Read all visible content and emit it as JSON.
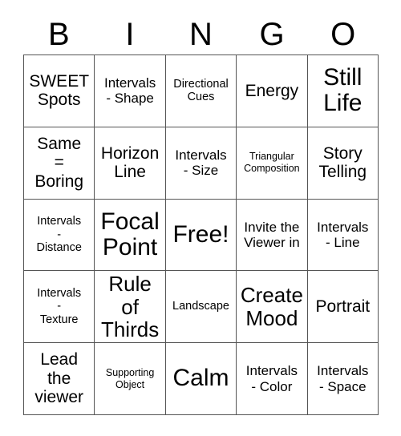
{
  "card": {
    "header_letters": [
      "B",
      "I",
      "N",
      "G",
      "O"
    ],
    "border_color": "#555555",
    "cell_background": "#ffffff",
    "text_color": "#000000",
    "columns": 5,
    "rows": 5
  },
  "cells": [
    {
      "text": "SWEET\nSpots",
      "size": "lg"
    },
    {
      "text": "Intervals\n- Shape",
      "size": "md"
    },
    {
      "text": "Directional\nCues",
      "size": "sm"
    },
    {
      "text": "Energy",
      "size": "lg"
    },
    {
      "text": "Still\nLife",
      "size": "xxl"
    },
    {
      "text": "Same\n=\nBoring",
      "size": "lg"
    },
    {
      "text": "Horizon\nLine",
      "size": "lg"
    },
    {
      "text": "Intervals\n- Size",
      "size": "md"
    },
    {
      "text": "Triangular\nComposition",
      "size": "xs"
    },
    {
      "text": "Story\nTelling",
      "size": "lg"
    },
    {
      "text": "Intervals\n-\nDistance",
      "size": "sm"
    },
    {
      "text": "Focal\nPoint",
      "size": "xxl"
    },
    {
      "text": "Free!",
      "size": "xxl"
    },
    {
      "text": "Invite the\nViewer in",
      "size": "md"
    },
    {
      "text": "Intervals\n- Line",
      "size": "md"
    },
    {
      "text": "Intervals\n-\nTexture",
      "size": "sm"
    },
    {
      "text": "Rule of\nThirds",
      "size": "xl"
    },
    {
      "text": "Landscape",
      "size": "sm"
    },
    {
      "text": "Create\nMood",
      "size": "xl"
    },
    {
      "text": "Portrait",
      "size": "lg"
    },
    {
      "text": "Lead\nthe\nviewer",
      "size": "lg"
    },
    {
      "text": "Supporting\nObject",
      "size": "xs"
    },
    {
      "text": "Calm",
      "size": "xxl"
    },
    {
      "text": "Intervals\n- Color",
      "size": "md"
    },
    {
      "text": "Intervals\n- Space",
      "size": "md"
    }
  ]
}
